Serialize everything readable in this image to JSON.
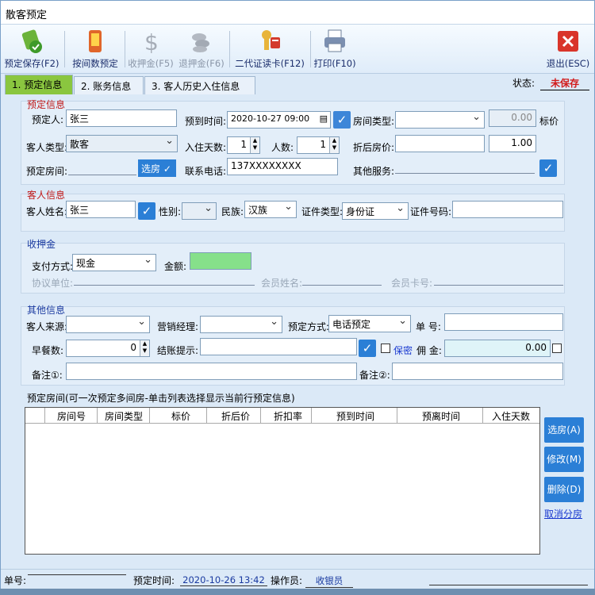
{
  "window": {
    "title": "散客预定"
  },
  "toolbar": {
    "save": "预定保存(F2)",
    "by_room": "按间数预定",
    "deposit_in": "收押金(F5)",
    "deposit_out": "退押金(F6)",
    "id_card": "二代证读卡(F12)",
    "print": "打印(F10)",
    "exit": "退出(ESC)"
  },
  "tabs": [
    "1. 预定信息",
    "2. 账务信息",
    "3. 客人历史入住信息"
  ],
  "status": {
    "label": "状态:",
    "value": "未保存"
  },
  "booking": {
    "section": "预定信息",
    "booker_label": "预定人:",
    "booker_value": "张三",
    "arrive_label": "预到时间:",
    "arrive_value": "2020-10-27 09:00",
    "room_type_label": "房间类型:",
    "room_type_value": "",
    "price_value": "0.00",
    "price_label": "标价",
    "guest_type_label": "客人类型:",
    "guest_type_value": "散客",
    "days_label": "入住天数:",
    "days_value": "1",
    "people_label": "人数:",
    "people_value": "1",
    "discount_price_label": "折后房价:",
    "discount_price_value": "",
    "discount_value": "1.00",
    "room_label": "预定房间:",
    "select_room_btn": "选房",
    "phone_label": "联系电话:",
    "phone_value": "137XXXXXXXX",
    "other_service_label": "其他服务:"
  },
  "guest": {
    "section": "客人信息",
    "name_label": "客人姓名:",
    "name_value": "张三",
    "gender_label": "性别:",
    "gender_value": "",
    "nation_label": "民族:",
    "nation_value": "汉族",
    "id_type_label": "证件类型:",
    "id_type_value": "身份证",
    "id_no_label": "证件号码:",
    "id_no_value": ""
  },
  "deposit": {
    "section": "收押金",
    "pay_label": "支付方式:",
    "pay_value": "现金",
    "amount_label": "金额:",
    "amount_value": "",
    "org_label": "协议单位:",
    "member_name_label": "会员姓名:",
    "member_card_label": "会员卡号:"
  },
  "other": {
    "section": "其他信息",
    "source_label": "客人来源:",
    "manager_label": "营销经理:",
    "method_label": "预定方式:",
    "method_value": "电话预定",
    "order_label": "单 号:",
    "breakfast_label": "早餐数:",
    "breakfast_value": "0",
    "settle_label": "结账提示:",
    "secret_label": "保密",
    "commission_label": "佣 金:",
    "commission_value": "0.00",
    "note1_label": "备注①:",
    "note2_label": "备注②:"
  },
  "rooms": {
    "title": "预定房间(可一次预定多间房-单击列表选择显示当前行预定信息)",
    "columns": [
      "房间号",
      "房间类型",
      "标价",
      "折后价",
      "折扣率",
      "预到时间",
      "预离时间",
      "入住天数"
    ],
    "btn_select": "选房(A)",
    "btn_edit": "修改(M)",
    "btn_delete": "删除(D)",
    "cancel_link": "取消分房"
  },
  "footer": {
    "order_label": "单号:",
    "order_value": "",
    "time_label": "预定时间:",
    "time_value": "2020-10-26 13:42",
    "operator_label": "操作员:",
    "operator_value": "收银员"
  }
}
